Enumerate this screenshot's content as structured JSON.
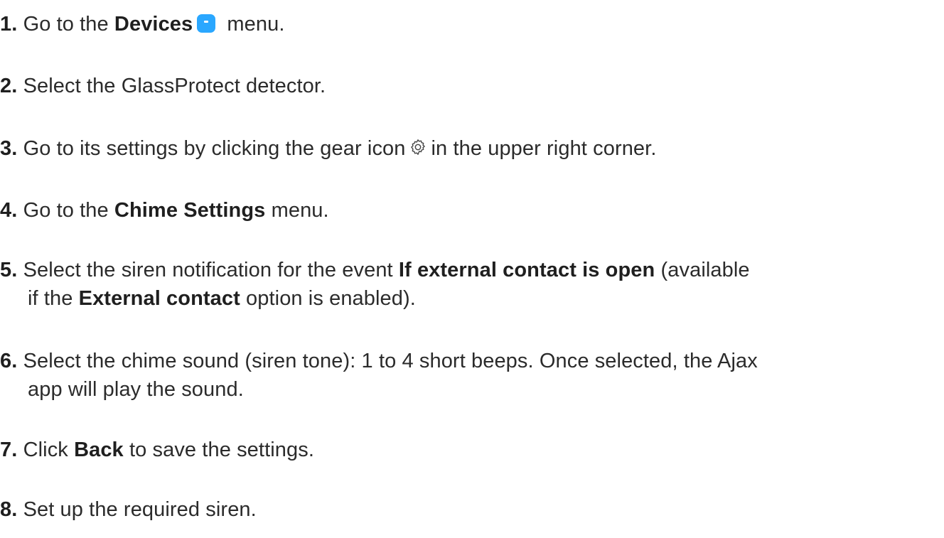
{
  "steps": [
    {
      "num": "1.",
      "t1": "Go to the ",
      "b1": "Devices",
      "icon": "devices-menu-icon",
      "t2": " menu."
    },
    {
      "num": "2.",
      "t1": "Select the GlassProtect detector."
    },
    {
      "num": "3.",
      "t1": "Go to its settings by clicking the gear icon",
      "icon": "gear-icon",
      "t2": "in the upper right corner."
    },
    {
      "num": "4.",
      "t1": "Go to the ",
      "b1": "Chime Settings",
      "t2": " menu."
    },
    {
      "num": "5.",
      "t1": "Select the siren notification for the event ",
      "b1": "If external contact is open",
      "t2": " (available",
      "l2a": "if the ",
      "b2": "External contact",
      "l2b": " option is enabled)."
    },
    {
      "num": "6.",
      "t1": "Select the chime sound (siren tone): 1 to 4 short beeps. Once selected, the Ajax",
      "l2": "app will play the sound."
    },
    {
      "num": "7.",
      "t1": "Click ",
      "b1": "Back",
      "t2": " to save the settings."
    },
    {
      "num": "8.",
      "t1": "Set up the required siren."
    }
  ],
  "colors": {
    "text": "#2b2b2b",
    "devices_icon": "#2aa7ff"
  }
}
